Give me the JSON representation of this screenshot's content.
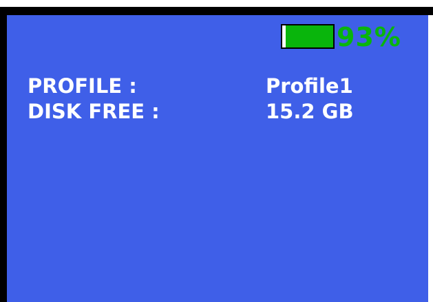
{
  "battery": {
    "level_percent": 93,
    "label": "93%",
    "fill_color": "#09b50c",
    "text_color": "#09b50c",
    "icon": "battery-icon"
  },
  "info": [
    {
      "label": "PROFILE :",
      "value": "Profile1"
    },
    {
      "label": "DISK FREE :",
      "value": "15.2 GB"
    }
  ],
  "colors": {
    "screen_background": "#3f5fe8",
    "bezel": "#000000",
    "text": "#ffffff"
  }
}
